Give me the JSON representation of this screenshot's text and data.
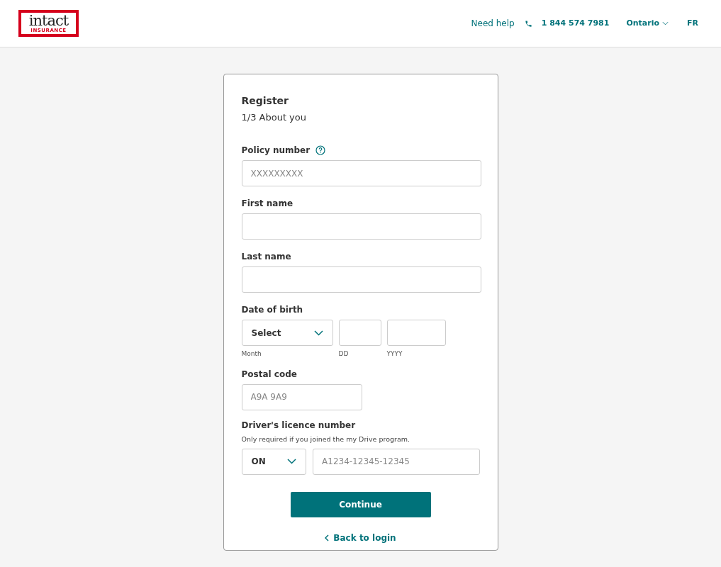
{
  "header": {
    "logo": {
      "wordmark": "intact",
      "tagline": "INSURANCE"
    },
    "help": "Need help",
    "phone": "1 844 574 7981",
    "province": "Ontario",
    "language": "FR"
  },
  "form": {
    "title": "Register",
    "step": "1/3 About you",
    "policy_number": {
      "label": "Policy number",
      "placeholder": "XXXXXXXXX"
    },
    "first_name": {
      "label": "First name"
    },
    "last_name": {
      "label": "Last name"
    },
    "date_of_birth": {
      "label": "Date of birth",
      "month": {
        "value": "Select",
        "caption": "Month"
      },
      "day": {
        "caption": "DD"
      },
      "year": {
        "caption": "YYYY"
      }
    },
    "postal_code": {
      "label": "Postal code",
      "placeholder": "A9A 9A9"
    },
    "licence": {
      "label": "Driver's licence number",
      "hint": "Only required if you joined the my Drive program.",
      "province": "ON",
      "placeholder": "A1234-12345-12345"
    },
    "continue": "Continue",
    "back": "Back to login"
  }
}
